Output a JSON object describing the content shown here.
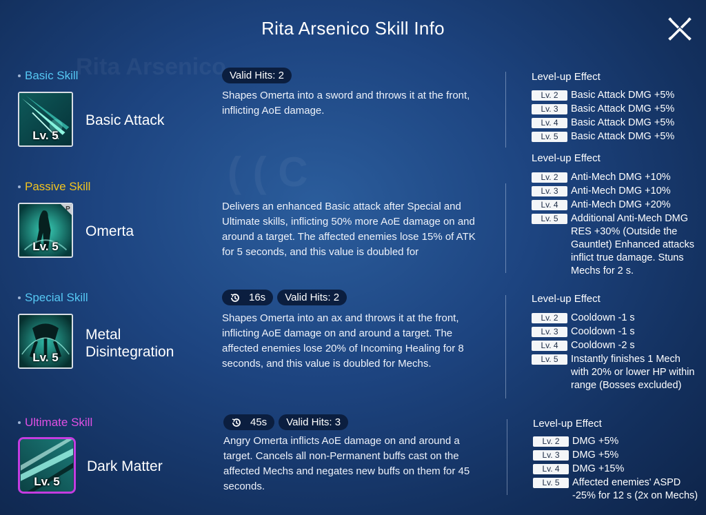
{
  "title": "Rita Arsenico Skill Info",
  "skills": [
    {
      "category": "Basic Skill",
      "name": "Basic Attack",
      "level": "Lv. 5",
      "tags": {
        "valid_hits": "Valid Hits: 2"
      },
      "description": "Shapes Omerta into a sword and throws it at the front, inflicting AoE damage.",
      "levelup_title": "Level-up Effect",
      "levelup": [
        {
          "lv": "Lv. 2",
          "text": "Basic Attack DMG +5%"
        },
        {
          "lv": "Lv. 3",
          "text": "Basic Attack DMG +5%"
        },
        {
          "lv": "Lv. 4",
          "text": "Basic Attack DMG +5%"
        },
        {
          "lv": "Lv. 5",
          "text": "Basic Attack DMG +5%"
        }
      ]
    },
    {
      "category": "Passive Skill",
      "name": "Omerta",
      "level": "Lv. 5",
      "badge": "P",
      "description": "Delivers an enhanced Basic attack after Special and Ultimate skills, inflicting 50% more AoE damage on and around a target. The affected enemies lose 15% of ATK for 5 seconds, and this value is doubled for",
      "levelup_title": "Level-up Effect",
      "levelup": [
        {
          "lv": "Lv. 2",
          "text": "Anti-Mech DMG +10%"
        },
        {
          "lv": "Lv. 3",
          "text": "Anti-Mech DMG +10%"
        },
        {
          "lv": "Lv. 4",
          "text": "Anti-Mech DMG +20%"
        },
        {
          "lv": "Lv. 5",
          "text": "Additional Anti-Mech DMG RES +30% (Outside the Gauntlet) Enhanced attacks inflict true damage. Stuns Mechs for 2 s."
        }
      ]
    },
    {
      "category": "Special Skill",
      "name": "Metal Disintegration",
      "level": "Lv. 5",
      "tags": {
        "cooldown": "16s",
        "valid_hits": "Valid Hits: 2"
      },
      "description": "Shapes Omerta into an ax and throws it at the front, inflicting AoE damage on and around a target. The affected enemies lose 20% of Incoming Healing for 8 seconds, and this value is doubled for Mechs.",
      "levelup_title": "Level-up Effect",
      "levelup": [
        {
          "lv": "Lv. 2",
          "text": "Cooldown -1 s"
        },
        {
          "lv": "Lv. 3",
          "text": "Cooldown -1 s"
        },
        {
          "lv": "Lv. 4",
          "text": "Cooldown -2 s"
        },
        {
          "lv": "Lv. 5",
          "text": "Instantly finishes 1 Mech with 20% or lower HP within range (Bosses excluded)"
        }
      ]
    },
    {
      "category": "Ultimate Skill",
      "name": "Dark Matter",
      "level": "Lv. 5",
      "tags": {
        "cooldown": "45s",
        "valid_hits": "Valid Hits: 3"
      },
      "description": "Angry Omerta inflicts AoE damage on and around a target. Cancels all non-Permanent buffs cast on the affected Mechs and negates new buffs on them for 45 seconds.",
      "levelup_title": "Level-up Effect",
      "levelup": [
        {
          "lv": "Lv. 2",
          "text": "DMG +5%"
        },
        {
          "lv": "Lv. 3",
          "text": "DMG +5%"
        },
        {
          "lv": "Lv. 4",
          "text": "DMG +15%"
        },
        {
          "lv": "Lv. 5",
          "text": "Affected enemies' ASPD -25% for 12 s (2x on Mechs)"
        }
      ]
    }
  ],
  "icons": {
    "close": "close-icon",
    "cooldown": "clock-history-icon"
  },
  "colors": {
    "basic": "#56c8f4",
    "passive": "#f4c41e",
    "special": "#56c8f4",
    "ultimate": "#e050e4",
    "tag_bg": "#0b1e3f"
  }
}
